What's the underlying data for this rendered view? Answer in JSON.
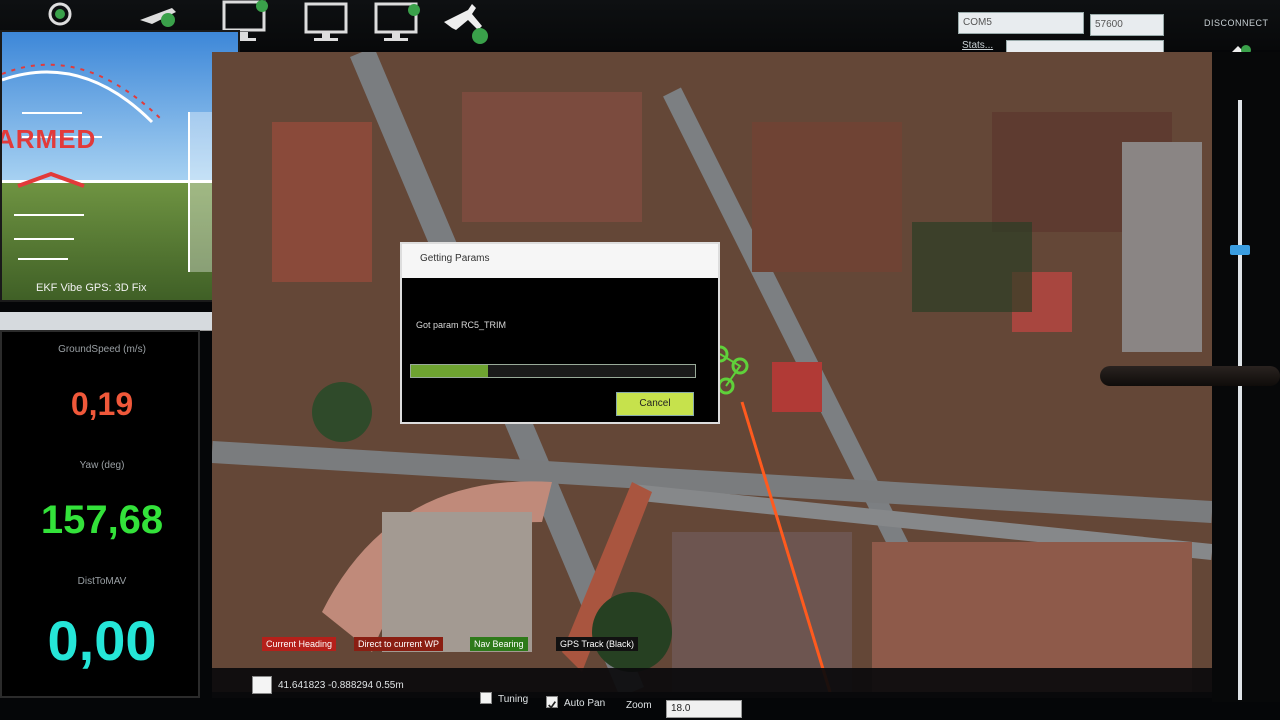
{
  "toolbar": {
    "icons": [
      "flight-data-icon",
      "flight-plan-icon",
      "monitor-icon",
      "monitor-icon",
      "monitor-icon",
      "plane-icon"
    ]
  },
  "connection": {
    "port": "COM5",
    "baud": "57600",
    "stats_label": "Stats...",
    "disconnect_label": "DISCONNECT"
  },
  "hud": {
    "armed_text": "ARMED",
    "status_text": "EKF  Vibe  GPS: 3D Fix"
  },
  "quick": {
    "ground_speed_label": "GroundSpeed (m/s)",
    "ground_speed_value": "0,19",
    "yaw_label": "Yaw (deg)",
    "yaw_value": "157,68",
    "third_label": "DistToMAV",
    "third_value": "0,00"
  },
  "map": {
    "legend_current_heading": "Current Heading",
    "legend_direct_to_current_wp": "Direct to current WP",
    "legend_nav_bearing": "Nav Bearing",
    "legend_gps_track": "GPS Track (Black)"
  },
  "bottom": {
    "coords": "41.641823 -0.888294  0.55m",
    "tuning_label": "Tuning",
    "autopan_label": "Auto Pan",
    "autopan_checked": true,
    "zoom_label": "Zoom",
    "zoom_value": "18.0"
  },
  "dialog": {
    "title": "Getting Params",
    "message": "Got param RC5_TRIM",
    "progress": 0.27,
    "cancel_label": "Cancel"
  },
  "colors": {
    "armed": "#e23a3a",
    "ground_speed": "#f0583a",
    "yaw": "#33e23a",
    "third": "#25e6d8",
    "cancel_button": "#c6e24c",
    "progress_fill": "#6ea331",
    "track_line": "#ff5a1e"
  }
}
